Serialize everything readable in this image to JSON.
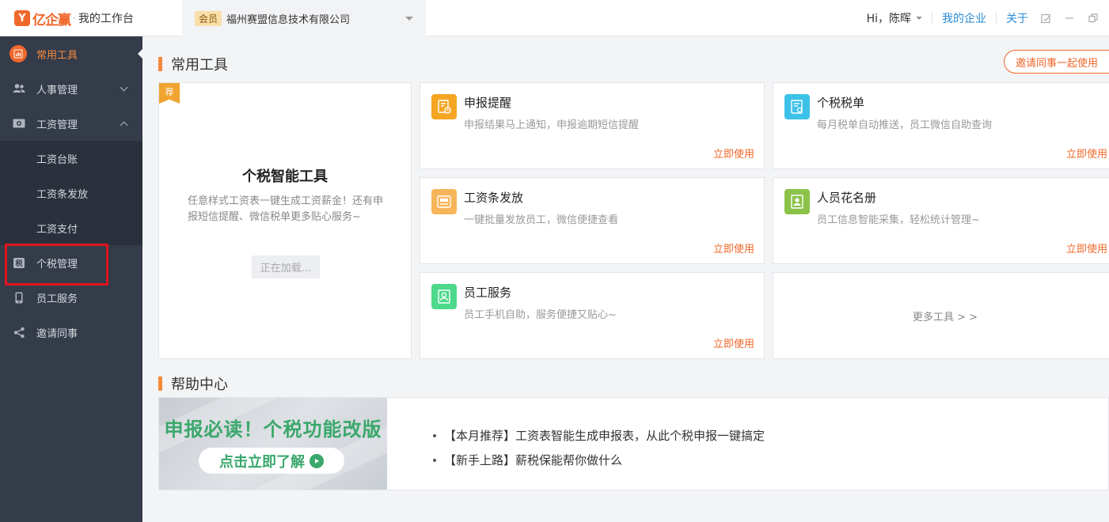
{
  "header": {
    "logo_mark": "Y",
    "brand": "亿企赢",
    "separator": "·",
    "subtitle": "我的工作台",
    "member_badge": "会员",
    "company_name": "福州赛盟信息技术有限公司",
    "greeting": "Hi，陈晖",
    "my_company": "我的企业",
    "about": "关于"
  },
  "sidebar": {
    "items": [
      {
        "label": "常用工具",
        "icon": "chart-icon"
      },
      {
        "label": "人事管理",
        "icon": "people-icon"
      },
      {
        "label": "工资管理",
        "icon": "payroll-icon"
      },
      {
        "label": "个税管理",
        "icon": "tax-icon",
        "icon_text": "税"
      },
      {
        "label": "员工服务",
        "icon": "phone-icon"
      },
      {
        "label": "邀请同事",
        "icon": "share-icon"
      }
    ],
    "sub_items": [
      "工资台账",
      "工资条发放",
      "工资支付"
    ]
  },
  "tools_section": {
    "title": "常用工具",
    "invite_button": "邀请同事一起使用"
  },
  "feature": {
    "tag": "荐",
    "title": "个税智能工具",
    "desc": "任意样式工资表一键生成工资薪金！还有申报短信提醒、微信税单更多贴心服务~",
    "loading": "正在加载..."
  },
  "tools": [
    {
      "name": "申报提醒",
      "desc": "申报结果马上通知，申报逾期短信提醒",
      "action": "立即使用",
      "color": "#f5a623"
    },
    {
      "name": "个税税单",
      "desc": "每月税单自动推送，员工微信自助查询",
      "action": "立即使用",
      "color": "#3cc1e8"
    },
    {
      "name": "工资条发放",
      "desc": "一键批量发放员工，微信便捷查看",
      "action": "立即使用",
      "color": "#f7b55a"
    },
    {
      "name": "人员花名册",
      "desc": "员工信息智能采集，轻松统计管理~",
      "action": "立即使用",
      "color": "#8bc34a"
    },
    {
      "name": "员工服务",
      "desc": "员工手机自助，服务便捷又贴心~",
      "action": "立即使用",
      "color": "#4cd98a"
    }
  ],
  "more_tools": "更多工具 > >",
  "help": {
    "title": "帮助中心",
    "banner_title": "申报必读！个税功能改版",
    "banner_button": "点击立即了解",
    "links": [
      "【本月推荐】工资表智能生成申报表，从此个税申报一键搞定",
      "【新手上路】薪税保能帮你做什么"
    ]
  },
  "colors": {
    "accent": "#f0672a",
    "sidebar_bg": "#343c4a",
    "highlight": "#e0141d",
    "link": "#2a8bd6"
  }
}
